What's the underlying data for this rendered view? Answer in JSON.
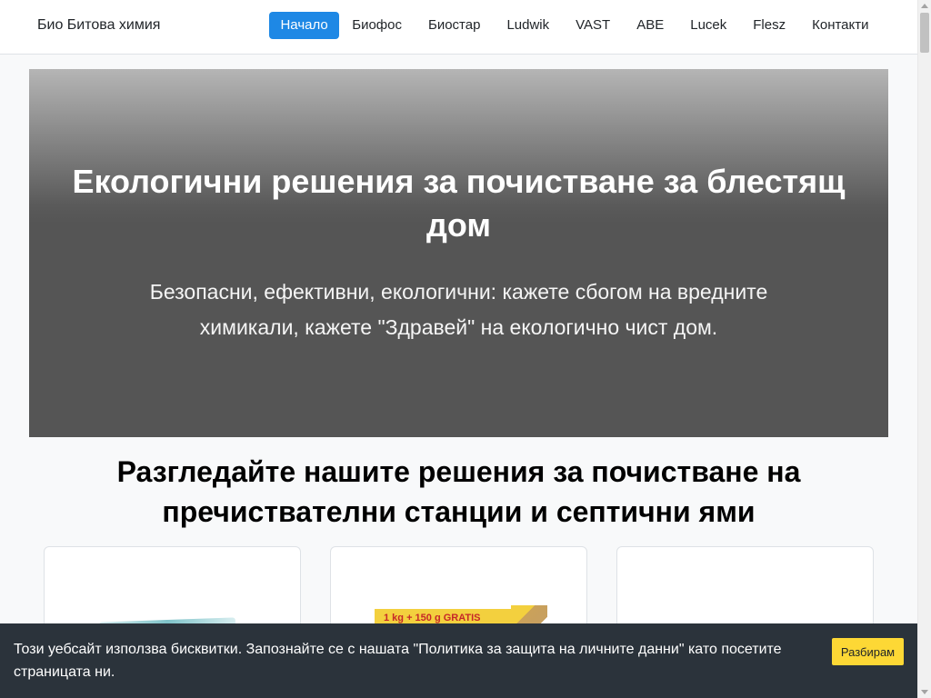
{
  "navbar": {
    "brand": "Био Битова химия",
    "items": [
      {
        "label": "Начало",
        "active": true
      },
      {
        "label": "Биофос"
      },
      {
        "label": "Биостар"
      },
      {
        "label": "Ludwik"
      },
      {
        "label": "VAST"
      },
      {
        "label": "ABE"
      },
      {
        "label": "Lucek"
      },
      {
        "label": "Flesz"
      },
      {
        "label": "Контакти"
      }
    ]
  },
  "hero": {
    "title": "Екологични решения за почистване за блестящ дом",
    "subtitle": "Безопасни, ефективни, екологични: кажете сбогом на вредните химикали, кажете \"Здравей\" на екологично чист дом."
  },
  "section": {
    "title": "Разгледайте нашите решения за почистване на пречиствателни станции и септични ями"
  },
  "cards": {
    "card2_promo": "1 kg + 150 g GRATIS"
  },
  "cookie": {
    "text": "Този уебсайт използва бисквитки. Запознайте се с нашата \"Политика за защита на личните данни\" като посетите страницата ни.",
    "button": "Разбирам"
  },
  "colors": {
    "accent": "#1e88e5",
    "cookie_bg": "#2b333b",
    "cookie_button": "#fdd835"
  }
}
